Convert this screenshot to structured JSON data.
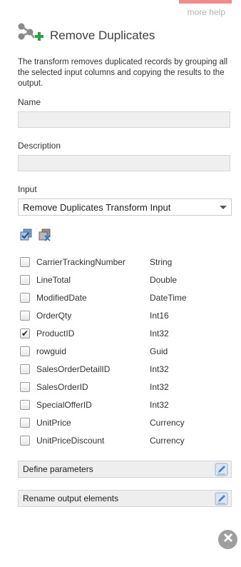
{
  "help_link": "more help",
  "title": "Remove Duplicates",
  "description": "The transform removes duplicated records by grouping all the selected input columns and copying the results to the output.",
  "name_label": "Name",
  "name_value": "",
  "description_label": "Description",
  "description_value": "",
  "input_label": "Input",
  "input_selected": "Remove Duplicates Transform Input",
  "columns": [
    {
      "name": "CarrierTrackingNumber",
      "type": "String",
      "checked": false
    },
    {
      "name": "LineTotal",
      "type": "Double",
      "checked": false
    },
    {
      "name": "ModifiedDate",
      "type": "DateTime",
      "checked": false
    },
    {
      "name": "OrderQty",
      "type": "Int16",
      "checked": false
    },
    {
      "name": "ProductID",
      "type": "Int32",
      "checked": true
    },
    {
      "name": "rowguid",
      "type": "Guid",
      "checked": false
    },
    {
      "name": "SalesOrderDetailID",
      "type": "Int32",
      "checked": false
    },
    {
      "name": "SalesOrderID",
      "type": "Int32",
      "checked": false
    },
    {
      "name": "SpecialOfferID",
      "type": "Int32",
      "checked": false
    },
    {
      "name": "UnitPrice",
      "type": "Currency",
      "checked": false
    },
    {
      "name": "UnitPriceDiscount",
      "type": "Currency",
      "checked": false
    }
  ],
  "define_parameters": "Define parameters",
  "rename_output": "Rename output elements",
  "icons": {
    "transform": "remove-duplicates-icon",
    "select_all": "select-all-icon",
    "deselect_all": "deselect-all-icon",
    "edit": "edit-pencil-icon",
    "close": "close-icon"
  },
  "colors": {
    "accent_green": "#2ea043",
    "tab_red": "#f08c8c",
    "close_gray": "#9e9e9e"
  }
}
